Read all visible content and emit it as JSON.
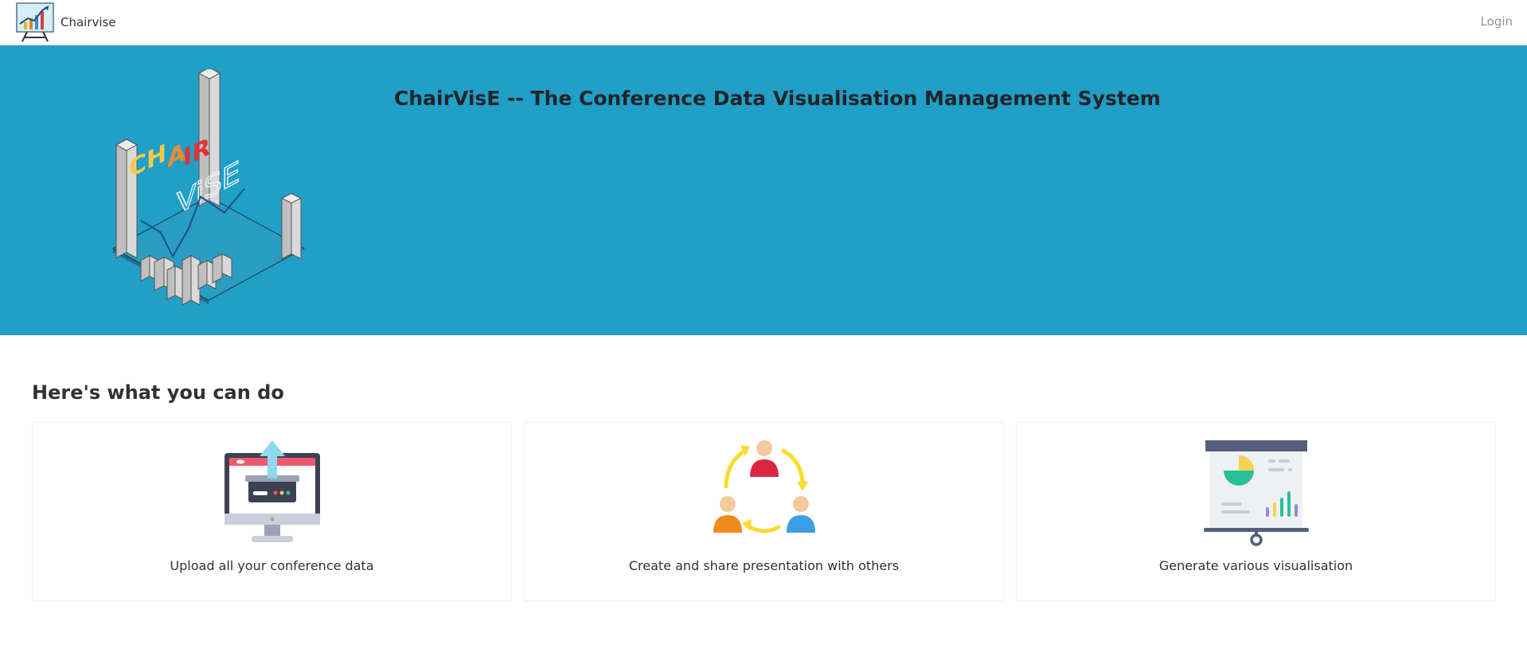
{
  "navbar": {
    "brand_name": "Chairvise",
    "login_label": "Login",
    "logo_icon": "presentation-chart-icon"
  },
  "hero": {
    "title": "ChairVisE -- The Conference Data Visualisation Management System",
    "logo_icon": "chairvise-isometric-logo",
    "logo_letters_top": "CHAIR",
    "logo_letters_bottom": "ViSE",
    "background_color": "#209fc7"
  },
  "features": {
    "heading": "Here's what you can do",
    "cards": [
      {
        "icon": "upload-monitor-icon",
        "text": "Upload all your conference data"
      },
      {
        "icon": "share-people-cycle-icon",
        "text": "Create and share presentation with others"
      },
      {
        "icon": "visualisation-board-icon",
        "text": "Generate various visualisation"
      }
    ]
  }
}
